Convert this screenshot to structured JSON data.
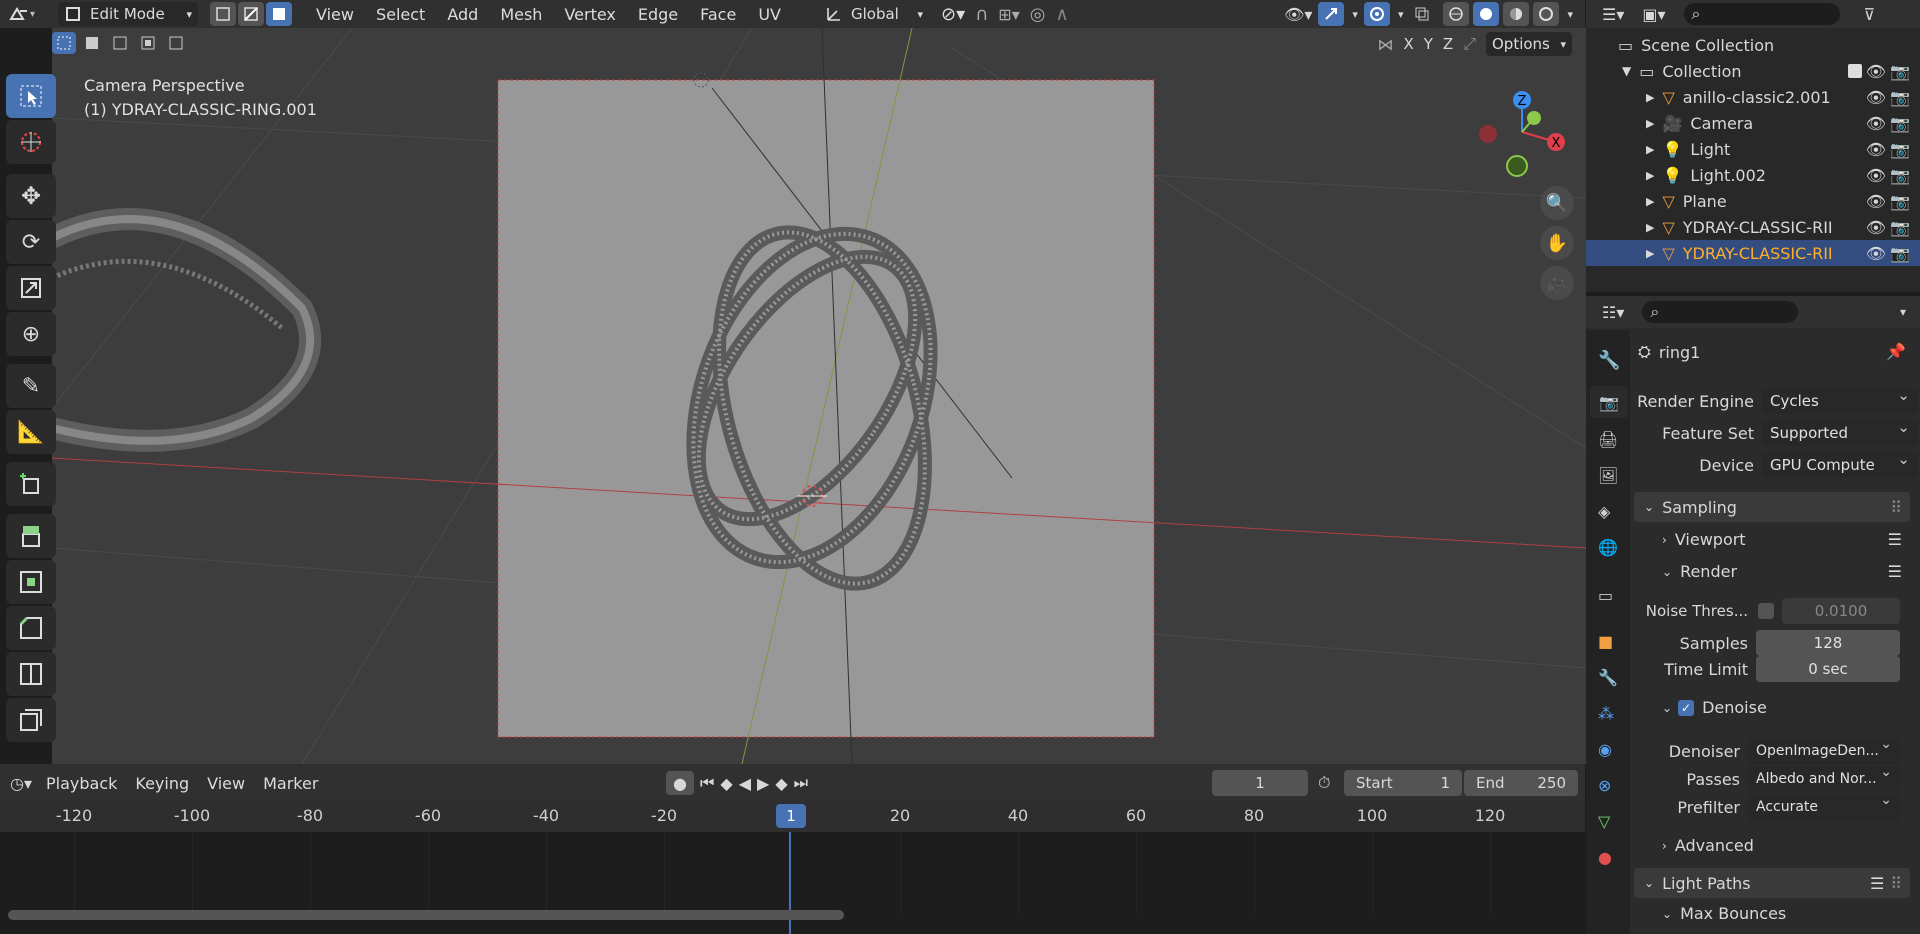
{
  "header": {
    "mode": "Edit Mode",
    "menus": [
      "View",
      "Select",
      "Add",
      "Mesh",
      "Vertex",
      "Edge",
      "Face",
      "UV"
    ],
    "orientation": "Global",
    "options_label": "Options",
    "axes": [
      "X",
      "Y",
      "Z"
    ]
  },
  "viewport": {
    "camera_label": "Camera Perspective",
    "object_label": "(1) YDRAY-CLASSIC-RING.001"
  },
  "outliner": {
    "scene_collection": "Scene Collection",
    "collection": "Collection",
    "items": [
      {
        "name": "anillo-classic2.001",
        "icon": "mesh-icon",
        "selected": false
      },
      {
        "name": "Camera",
        "icon": "camera-icon",
        "selected": false
      },
      {
        "name": "Light",
        "icon": "light-icon",
        "selected": false
      },
      {
        "name": "Light.002",
        "icon": "light-icon",
        "selected": false
      },
      {
        "name": "Plane",
        "icon": "mesh-icon",
        "selected": false
      },
      {
        "name": "YDRAY-CLASSIC-RII",
        "icon": "mesh-icon",
        "selected": false
      },
      {
        "name": "YDRAY-CLASSIC-RII",
        "icon": "mesh-icon",
        "selected": true
      }
    ]
  },
  "properties": {
    "scene_name": "ring1",
    "render_engine_label": "Render Engine",
    "render_engine": "Cycles",
    "feature_set_label": "Feature Set",
    "feature_set": "Supported",
    "device_label": "Device",
    "device": "GPU Compute",
    "sampling": "Sampling",
    "viewport": "Viewport",
    "render": "Render",
    "noise_threshold_label": "Noise Thres...",
    "noise_threshold": "0.0100",
    "samples_label": "Samples",
    "samples": "128",
    "time_limit_label": "Time Limit",
    "time_limit": "0 sec",
    "denoise": "Denoise",
    "denoiser_label": "Denoiser",
    "denoiser": "OpenImageDen...",
    "passes_label": "Passes",
    "passes": "Albedo and Nor...",
    "prefilter_label": "Prefilter",
    "prefilter": "Accurate",
    "advanced": "Advanced",
    "light_paths": "Light Paths",
    "max_bounces": "Max Bounces"
  },
  "timeline": {
    "playback": "Playback",
    "keying": "Keying",
    "view": "View",
    "marker": "Marker",
    "current_frame": "1",
    "start_label": "Start",
    "start": "1",
    "end_label": "End",
    "end": "250",
    "ticks": [
      "-120",
      "-100",
      "-80",
      "-60",
      "-40",
      "-20",
      "1",
      "20",
      "40",
      "60",
      "80",
      "100",
      "120"
    ]
  },
  "colors": {
    "accent": "#4772b3",
    "selected_text": "#ffaf29",
    "x_axis": "#e0404c",
    "y_axis": "#8cc84a",
    "z_axis": "#3b8ff0"
  }
}
